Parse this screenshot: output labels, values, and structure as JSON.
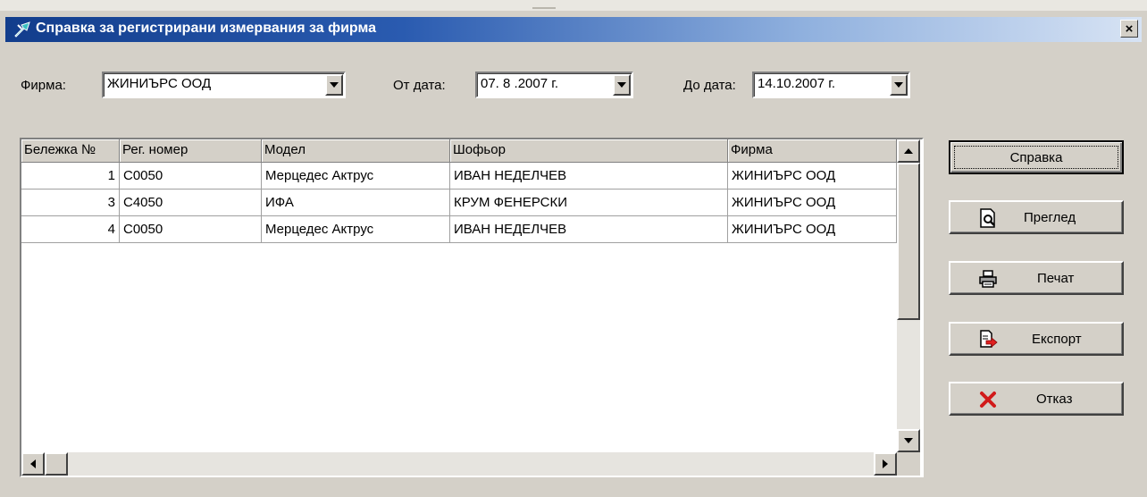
{
  "window": {
    "title": "Справка за регистрирани измервания за фирма",
    "close_label": "×"
  },
  "filters": {
    "firm_label": "Фирма:",
    "firm_value": "ЖИНИЪРС ООД",
    "from_label": "От дата:",
    "from_value": "07. 8 .2007 г.",
    "to_label": "До дата:",
    "to_value": "14.10.2007 г."
  },
  "table": {
    "columns": [
      "Бележка №",
      "Рег. номер",
      "Модел",
      "Шофьор",
      "Фирма"
    ],
    "rows": [
      [
        "1",
        "C0050",
        "Мерцедес Актрус",
        "ИВАН НЕДЕЛЧЕВ",
        "ЖИНИЪРС ООД"
      ],
      [
        "3",
        "C4050",
        "ИФА",
        "КРУМ ФЕНЕРСКИ",
        "ЖИНИЪРС ООД"
      ],
      [
        "4",
        "C0050",
        "Мерцедес Актрус",
        "ИВАН НЕДЕЛЧЕВ",
        "ЖИНИЪРС ООД"
      ]
    ]
  },
  "buttons": {
    "report": "Справка",
    "preview": "Преглед",
    "print": "Печат",
    "export": "Експорт",
    "cancel": "Отказ"
  },
  "icons": {
    "title": "app-icon",
    "preview": "magnifier-document-icon",
    "print": "printer-icon",
    "export": "export-arrow-icon",
    "cancel": "red-x-icon"
  },
  "colors": {
    "titlebar_start": "#123d8c",
    "titlebar_end": "#d7e3f4",
    "face": "#d4d0c8",
    "cancel_x": "#d11a1a",
    "export_arrow": "#e02020"
  }
}
